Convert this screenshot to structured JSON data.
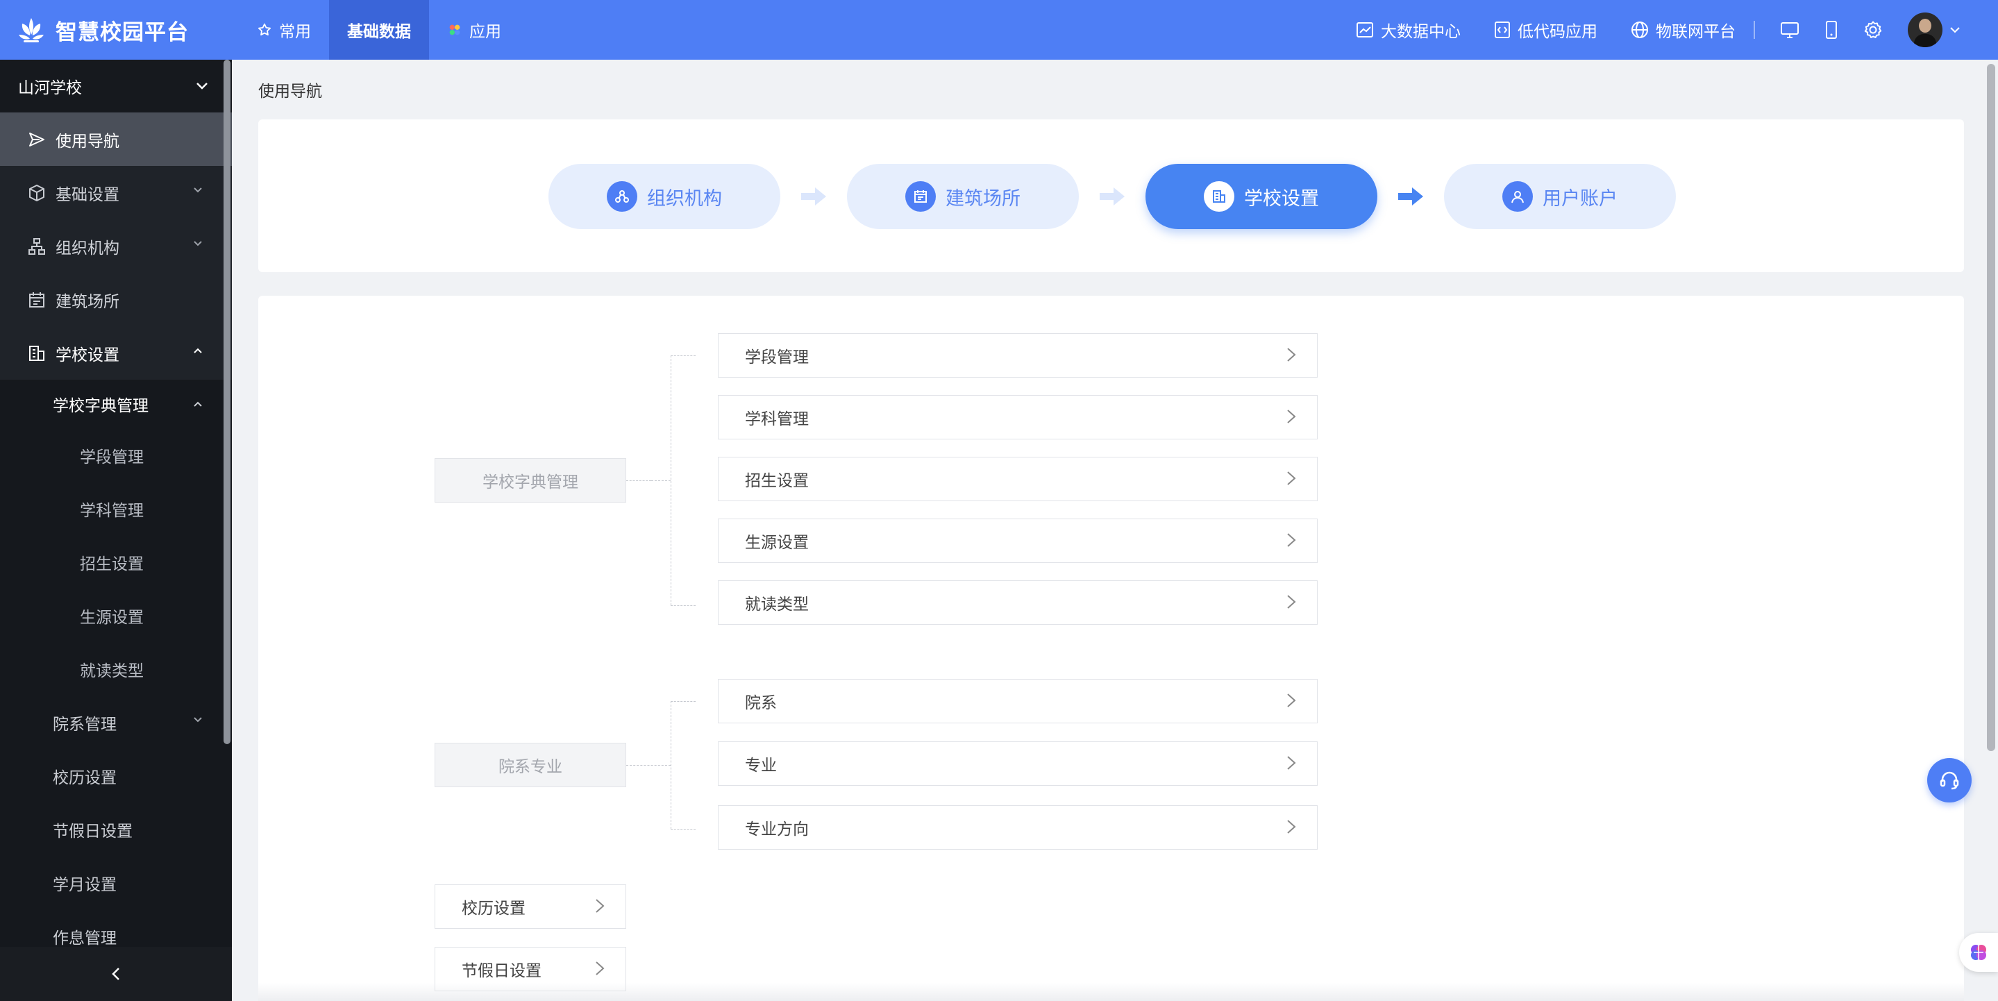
{
  "brand": {
    "name": "智慧校园平台"
  },
  "topnav": [
    {
      "label": "常用",
      "icon": "star-icon"
    },
    {
      "label": "基础数据",
      "active": true
    },
    {
      "label": "应用",
      "icon": "apps-icon"
    }
  ],
  "topright": {
    "bigdata": "大数据中心",
    "lowcode": "低代码应用",
    "iot": "物联网平台"
  },
  "sidebar": {
    "school": "山河学校",
    "items": [
      {
        "label": "使用导航",
        "icon": "send-icon",
        "active": true
      },
      {
        "label": "基础设置",
        "icon": "cube-icon"
      },
      {
        "label": "组织机构",
        "icon": "org-tree-icon"
      },
      {
        "label": "建筑场所",
        "icon": "calendar-building-icon"
      },
      {
        "label": "学校设置",
        "icon": "building-icon",
        "open": true
      }
    ],
    "school_settings_sub": {
      "dict": "学校字典管理",
      "dict_items": [
        "学段管理",
        "学科管理",
        "招生设置",
        "生源设置",
        "就读类型"
      ],
      "faculty": "院系管理",
      "calendar": "校历设置",
      "holiday": "节假日设置",
      "month": "学月设置",
      "schedule": "作息管理"
    }
  },
  "breadcrumb": "使用导航",
  "steps": [
    {
      "label": "组织机构",
      "icon": "org-icon"
    },
    {
      "label": "建筑场所",
      "icon": "building-icon"
    },
    {
      "label": "学校设置",
      "icon": "school-icon",
      "active": true
    },
    {
      "label": "用户账户",
      "icon": "user-icon"
    }
  ],
  "tree": {
    "group1": {
      "label": "学校字典管理",
      "children": [
        "学段管理",
        "学科管理",
        "招生设置",
        "生源设置",
        "就读类型"
      ]
    },
    "group2": {
      "label": "院系专业",
      "children": [
        "院系",
        "专业",
        "专业方向"
      ]
    },
    "singles": [
      "校历设置",
      "节假日设置"
    ]
  },
  "chevron": ">",
  "colors": {
    "primary": "#4e7ef5",
    "sidebar_bg": "#1f2329",
    "step_bg": "#e6eefd"
  }
}
